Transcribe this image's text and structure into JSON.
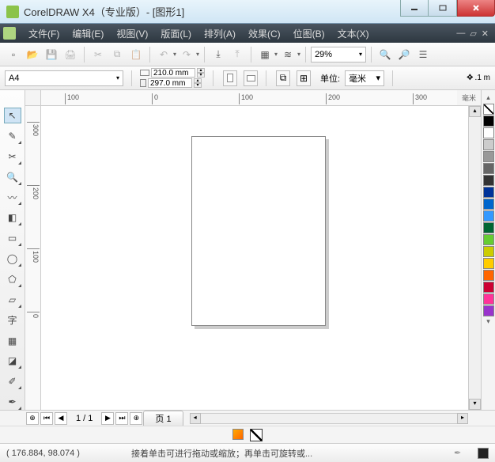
{
  "window": {
    "title": "CorelDRAW X4（专业版）- [图形1]"
  },
  "menu": {
    "file": "文件(F)",
    "edit": "编辑(E)",
    "view": "视图(V)",
    "layout": "版面(L)",
    "arrange": "排列(A)",
    "effects": "效果(C)",
    "bitmap": "位图(B)",
    "text": "文本(X)"
  },
  "toolbar": {
    "zoom": "29%"
  },
  "property": {
    "paper": "A4",
    "width": "210.0 mm",
    "height": "297.0 mm",
    "units_label": "单位:",
    "units_value": "毫米",
    "nudge": ".1 m"
  },
  "ruler": {
    "unit_label": "毫米",
    "h_ticks": [
      {
        "pos": 30,
        "label": "100"
      },
      {
        "pos": 140,
        "label": "0"
      },
      {
        "pos": 250,
        "label": "100"
      },
      {
        "pos": 360,
        "label": "200"
      },
      {
        "pos": 470,
        "label": "300"
      }
    ],
    "v_ticks": [
      {
        "pos": 20,
        "label": "300"
      },
      {
        "pos": 100,
        "label": "200"
      },
      {
        "pos": 180,
        "label": "100"
      },
      {
        "pos": 260,
        "label": "0"
      }
    ]
  },
  "pagenav": {
    "counter": "1 / 1",
    "tab": "页 1"
  },
  "status": {
    "coords": "( 176.884, 98.074 )",
    "hint": "接着单击可进行拖动或缩放；再单击可旋转或..."
  },
  "palette": [
    "none",
    "#000000",
    "#ffffff",
    "#cccccc",
    "#999999",
    "#666666",
    "#333333",
    "#003399",
    "#0066cc",
    "#3399ff",
    "#006633",
    "#66cc33",
    "#cccc00",
    "#ffcc00",
    "#ff6600",
    "#cc0033",
    "#ff3399",
    "#9933cc"
  ]
}
